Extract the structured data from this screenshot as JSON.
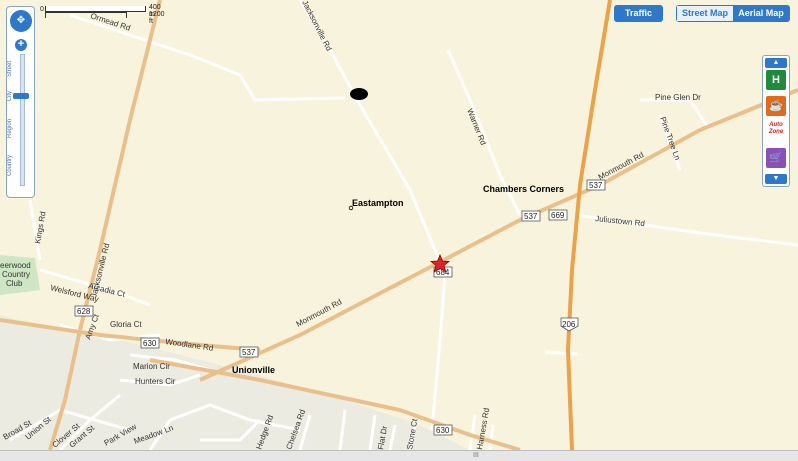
{
  "scale": {
    "zero": "0",
    "meters": "400 m",
    "feet": "1200 ft"
  },
  "zoom": {
    "pan_glyph": "✥",
    "plus": "+",
    "minus": "−",
    "levels": [
      "Street",
      "City",
      "Region",
      "Country"
    ]
  },
  "controls": {
    "traffic_label": "Traffic",
    "street_map_label": "Street Map",
    "aerial_map_label": "Aerial Map",
    "active_map_type": "Street Map"
  },
  "poi_bar": {
    "items": [
      "hotel-icon",
      "coffee-icon",
      "auto-zone-icon",
      "shopping-icon"
    ],
    "auto_zone_line1": "Auto",
    "auto_zone_line2": "Zone",
    "up_arrow": "▲",
    "down_arrow": "▼"
  },
  "places": {
    "eastampton": "Eastampton",
    "chambers_corners": "Chambers Corners",
    "unionville": "Unionville",
    "country_club_line1": "eerwood",
    "country_club_line2": "Country",
    "country_club_line3": "Club"
  },
  "roads": {
    "jacksonville_rd_top": "Jacksonville Rd",
    "jacksonville_rd_left": "Jacksonville Rd",
    "ormead_rd": "Ormead Rd",
    "warner_rd": "Warner Rd",
    "monmouth_rd_east": "Monmouth Rd",
    "monmouth_rd_west": "Monmouth Rd",
    "juliustown_rd": "Juliustown Rd",
    "pine_glen_dr": "Pine Glen Dr",
    "pine_tree_ln": "Pine Tree Ln",
    "kings_rd": "Kings Rd",
    "arcadia_ct": "Arcadia Ct",
    "welsford_way": "Welsford Way",
    "amy_ct": "Amy Ct",
    "gloria_ct": "Gloria Ct",
    "woodlane_rd": "Woodlane Rd",
    "marion_cir": "Marion Cir",
    "hunters_cir": "Hunters Cir",
    "broad_st": "Broad St",
    "union_st": "Union St",
    "clover_st": "Clover St",
    "grant_st": "Grant St",
    "park_view": "Park View",
    "meadow_ln": "Meadow Ln",
    "chelsea_rd": "Chelsea Rd",
    "hedge_rd": "Hedge Rd",
    "harness_rd": "Harness Rd",
    "stone_ct": "Stone Ct",
    "flat_dr": "Flat Dr"
  },
  "shields": {
    "r537_a": "537",
    "r537_b": "537",
    "r537_c": "537",
    "r669": "669",
    "r684": "684",
    "r628": "628",
    "r630_a": "630",
    "r630_b": "630",
    "us206": "206"
  },
  "bottom_grip": "III",
  "colors": {
    "land": "#f7f3dc",
    "major_road": "#e9c08b",
    "us_highway": "#eaa24b",
    "minor_road": "#ffffff",
    "developed": "#ecebe1",
    "accent": "#2f77c8",
    "pin": "#d8262a"
  }
}
